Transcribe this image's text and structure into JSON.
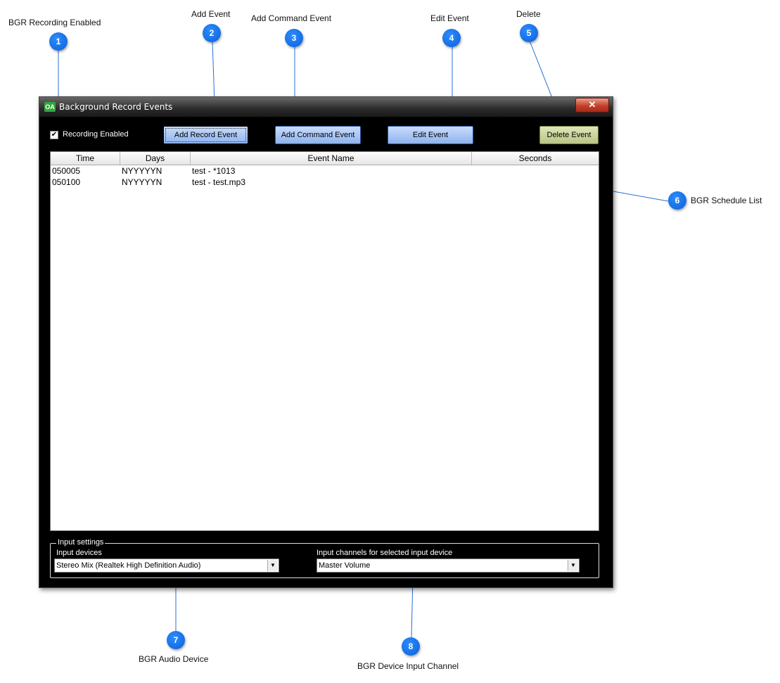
{
  "window": {
    "title": "Background Record Events",
    "icon_text": "OA",
    "close_glyph": "✕"
  },
  "toolbar": {
    "recording_enabled_label": "Recording Enabled",
    "recording_enabled_checked": true,
    "check_glyph": "✔",
    "add_record_label": "Add Record Event",
    "add_command_label": "Add Command Event",
    "edit_label": "Edit Event",
    "delete_label": "Delete Event"
  },
  "schedule": {
    "columns": [
      "Time",
      "Days",
      "Event Name",
      "Seconds"
    ],
    "rows": [
      {
        "time": "050005",
        "days": "NYYYYYN",
        "name": "test - *1013",
        "seconds": ""
      },
      {
        "time": "050100",
        "days": "NYYYYYN",
        "name": "test - test.mp3",
        "seconds": ""
      }
    ]
  },
  "input_settings": {
    "group_title": "Input settings",
    "devices_label": "Input devices",
    "devices_value": "Stereo Mix (Realtek High Definition Audio)",
    "channels_label": "Input channels for selected input device",
    "channels_value": "Master Volume",
    "dropdown_glyph": "▼"
  },
  "callouts": [
    {
      "number": "1",
      "label": "BGR Recording Enabled"
    },
    {
      "number": "2",
      "label": "Add Event"
    },
    {
      "number": "3",
      "label": "Add Command Event"
    },
    {
      "number": "4",
      "label": "Edit Event"
    },
    {
      "number": "5",
      "label": "Delete"
    },
    {
      "number": "6",
      "label": "BGR Schedule List"
    },
    {
      "number": "7",
      "label": "BGR Audio Device"
    },
    {
      "number": "8",
      "label": "BGR Device Input Channel"
    }
  ],
  "colors": {
    "callout_blue": "#1a73e8",
    "button_blue": "#a9c6f6",
    "button_green": "#cbd59c",
    "close_red": "#c4402a"
  }
}
